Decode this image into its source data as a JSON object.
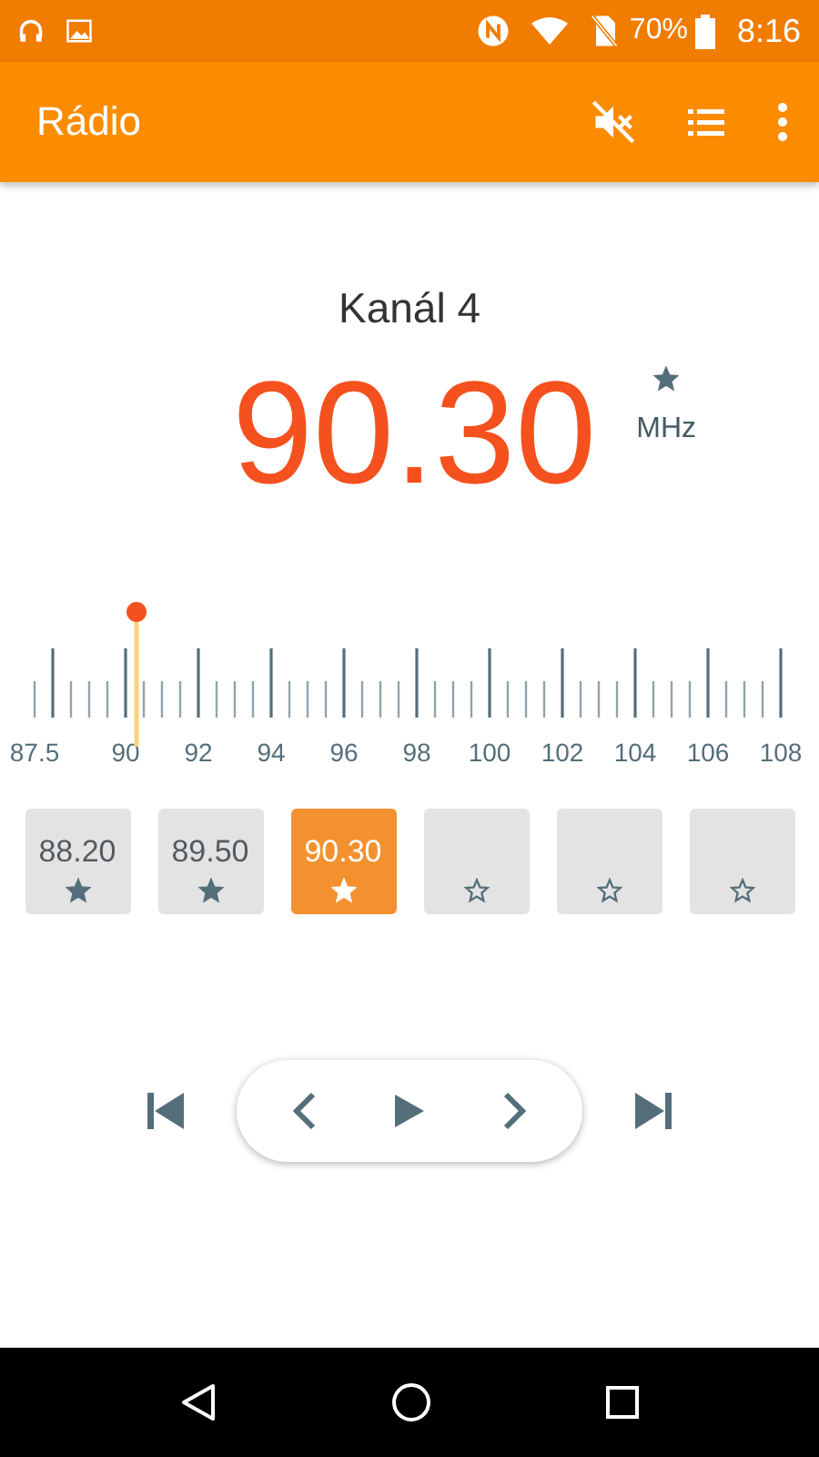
{
  "status_bar": {
    "battery": "70%",
    "time": "8:16"
  },
  "app_bar": {
    "title": "Rádio"
  },
  "station": {
    "name": "Kanál 4",
    "frequency": "90.30",
    "unit": "MHz",
    "favorite": true
  },
  "tuner": {
    "labels": [
      "87.5",
      "90",
      "92",
      "94",
      "96",
      "98",
      "100",
      "102",
      "104",
      "106",
      "108"
    ]
  },
  "presets": [
    {
      "label": "88.20",
      "starred": true,
      "selected": false
    },
    {
      "label": "89.50",
      "starred": true,
      "selected": false
    },
    {
      "label": "90.30",
      "starred": true,
      "selected": true
    },
    {
      "starred": false,
      "selected": false
    },
    {
      "starred": false,
      "selected": false
    },
    {
      "starred": false,
      "selected": false
    }
  ]
}
